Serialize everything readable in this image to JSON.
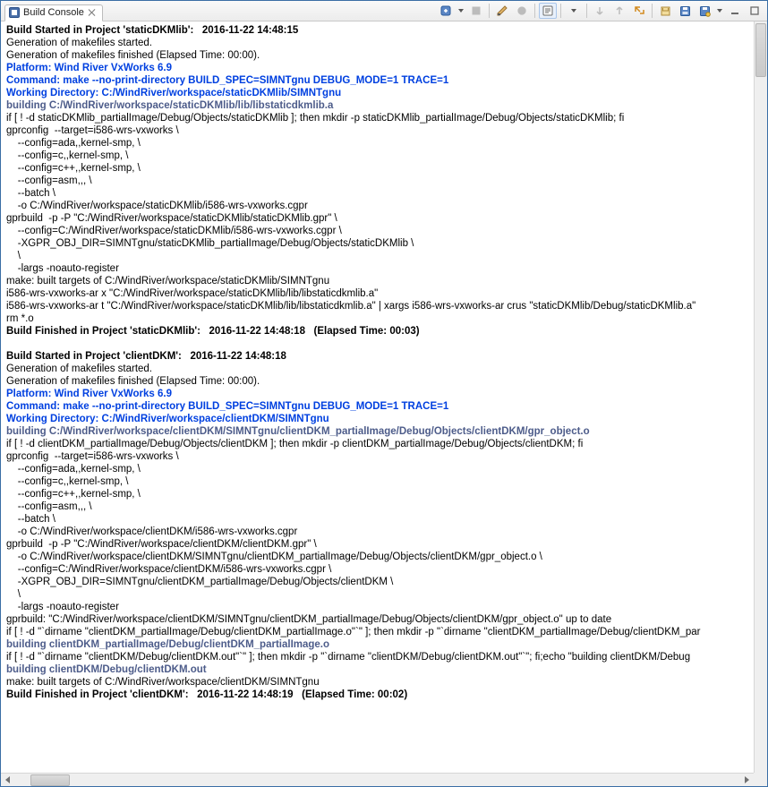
{
  "tab": {
    "title": "Build Console"
  },
  "log": {
    "lines": [
      {
        "cls": "b",
        "text": "Build Started in Project 'staticDKMlib':   2016-11-22 14:48:15"
      },
      {
        "cls": "",
        "text": "Generation of makefiles started."
      },
      {
        "cls": "",
        "text": "Generation of makefiles finished (Elapsed Time: 00:00)."
      },
      {
        "cls": "b blue",
        "text": "Platform: Wind River VxWorks 6.9"
      },
      {
        "cls": "b blue",
        "text": "Command: make --no-print-directory BUILD_SPEC=SIMNTgnu DEBUG_MODE=1 TRACE=1"
      },
      {
        "cls": "b blue",
        "text": "Working Directory: C:/WindRiver/workspace/staticDKMlib/SIMNTgnu"
      },
      {
        "cls": "b dblue",
        "text": "building C:/WindRiver/workspace/staticDKMlib/lib/libstaticdkmlib.a"
      },
      {
        "cls": "",
        "text": "if [ ! -d staticDKMlib_partialImage/Debug/Objects/staticDKMlib ]; then mkdir -p staticDKMlib_partialImage/Debug/Objects/staticDKMlib; fi"
      },
      {
        "cls": "",
        "text": "gprconfig  --target=i586-wrs-vxworks \\"
      },
      {
        "cls": "",
        "text": "    --config=ada,,kernel-smp, \\"
      },
      {
        "cls": "",
        "text": "    --config=c,,kernel-smp, \\"
      },
      {
        "cls": "",
        "text": "    --config=c++,,kernel-smp, \\"
      },
      {
        "cls": "",
        "text": "    --config=asm,,, \\"
      },
      {
        "cls": "",
        "text": "    --batch \\"
      },
      {
        "cls": "",
        "text": "    -o C:/WindRiver/workspace/staticDKMlib/i586-wrs-vxworks.cgpr"
      },
      {
        "cls": "",
        "text": "gprbuild  -p -P \"C:/WindRiver/workspace/staticDKMlib/staticDKMlib.gpr\" \\"
      },
      {
        "cls": "",
        "text": "    --config=C:/WindRiver/workspace/staticDKMlib/i586-wrs-vxworks.cgpr \\"
      },
      {
        "cls": "",
        "text": "    -XGPR_OBJ_DIR=SIMNTgnu/staticDKMlib_partialImage/Debug/Objects/staticDKMlib \\"
      },
      {
        "cls": "",
        "text": "    \\"
      },
      {
        "cls": "",
        "text": "    -largs -noauto-register"
      },
      {
        "cls": "",
        "text": "make: built targets of C:/WindRiver/workspace/staticDKMlib/SIMNTgnu"
      },
      {
        "cls": "",
        "text": "i586-wrs-vxworks-ar x \"C:/WindRiver/workspace/staticDKMlib/lib/libstaticdkmlib.a\""
      },
      {
        "cls": "",
        "text": "i586-wrs-vxworks-ar t \"C:/WindRiver/workspace/staticDKMlib/lib/libstaticdkmlib.a\" | xargs i586-wrs-vxworks-ar crus \"staticDKMlib/Debug/staticDKMlib.a\""
      },
      {
        "cls": "",
        "text": "rm *.o"
      },
      {
        "cls": "b",
        "text": "Build Finished in Project 'staticDKMlib':   2016-11-22 14:48:18   (Elapsed Time: 00:03)"
      },
      {
        "cls": "",
        "text": " "
      },
      {
        "cls": "b",
        "text": "Build Started in Project 'clientDKM':   2016-11-22 14:48:18"
      },
      {
        "cls": "",
        "text": "Generation of makefiles started."
      },
      {
        "cls": "",
        "text": "Generation of makefiles finished (Elapsed Time: 00:00)."
      },
      {
        "cls": "b blue",
        "text": "Platform: Wind River VxWorks 6.9"
      },
      {
        "cls": "b blue",
        "text": "Command: make --no-print-directory BUILD_SPEC=SIMNTgnu DEBUG_MODE=1 TRACE=1"
      },
      {
        "cls": "b blue",
        "text": "Working Directory: C:/WindRiver/workspace/clientDKM/SIMNTgnu"
      },
      {
        "cls": "b dblue",
        "text": "building C:/WindRiver/workspace/clientDKM/SIMNTgnu/clientDKM_partialImage/Debug/Objects/clientDKM/gpr_object.o"
      },
      {
        "cls": "",
        "text": "if [ ! -d clientDKM_partialImage/Debug/Objects/clientDKM ]; then mkdir -p clientDKM_partialImage/Debug/Objects/clientDKM; fi"
      },
      {
        "cls": "",
        "text": "gprconfig  --target=i586-wrs-vxworks \\"
      },
      {
        "cls": "",
        "text": "    --config=ada,,kernel-smp, \\"
      },
      {
        "cls": "",
        "text": "    --config=c,,kernel-smp, \\"
      },
      {
        "cls": "",
        "text": "    --config=c++,,kernel-smp, \\"
      },
      {
        "cls": "",
        "text": "    --config=asm,,, \\"
      },
      {
        "cls": "",
        "text": "    --batch \\"
      },
      {
        "cls": "",
        "text": "    -o C:/WindRiver/workspace/clientDKM/i586-wrs-vxworks.cgpr"
      },
      {
        "cls": "",
        "text": "gprbuild  -p -P \"C:/WindRiver/workspace/clientDKM/clientDKM.gpr\" \\"
      },
      {
        "cls": "",
        "text": "    -o C:/WindRiver/workspace/clientDKM/SIMNTgnu/clientDKM_partialImage/Debug/Objects/clientDKM/gpr_object.o \\"
      },
      {
        "cls": "",
        "text": "    --config=C:/WindRiver/workspace/clientDKM/i586-wrs-vxworks.cgpr \\"
      },
      {
        "cls": "",
        "text": "    -XGPR_OBJ_DIR=SIMNTgnu/clientDKM_partialImage/Debug/Objects/clientDKM \\"
      },
      {
        "cls": "",
        "text": "    \\"
      },
      {
        "cls": "",
        "text": "    -largs -noauto-register"
      },
      {
        "cls": "",
        "text": "gprbuild: \"C:/WindRiver/workspace/clientDKM/SIMNTgnu/clientDKM_partialImage/Debug/Objects/clientDKM/gpr_object.o\" up to date"
      },
      {
        "cls": "",
        "text": "if [ ! -d \"`dirname \"clientDKM_partialImage/Debug/clientDKM_partialImage.o\"`\" ]; then mkdir -p \"`dirname \"clientDKM_partialImage/Debug/clientDKM_par"
      },
      {
        "cls": "b dblue",
        "text": "building clientDKM_partialImage/Debug/clientDKM_partialImage.o"
      },
      {
        "cls": "",
        "text": "if [ ! -d \"`dirname \"clientDKM/Debug/clientDKM.out\"`\" ]; then mkdir -p \"`dirname \"clientDKM/Debug/clientDKM.out\"`\"; fi;echo \"building clientDKM/Debug"
      },
      {
        "cls": "b dblue",
        "text": "building clientDKM/Debug/clientDKM.out"
      },
      {
        "cls": "",
        "text": "make: built targets of C:/WindRiver/workspace/clientDKM/SIMNTgnu"
      },
      {
        "cls": "b",
        "text": "Build Finished in Project 'clientDKM':   2016-11-22 14:48:19   (Elapsed Time: 00:02)"
      },
      {
        "cls": "",
        "text": " "
      }
    ]
  }
}
